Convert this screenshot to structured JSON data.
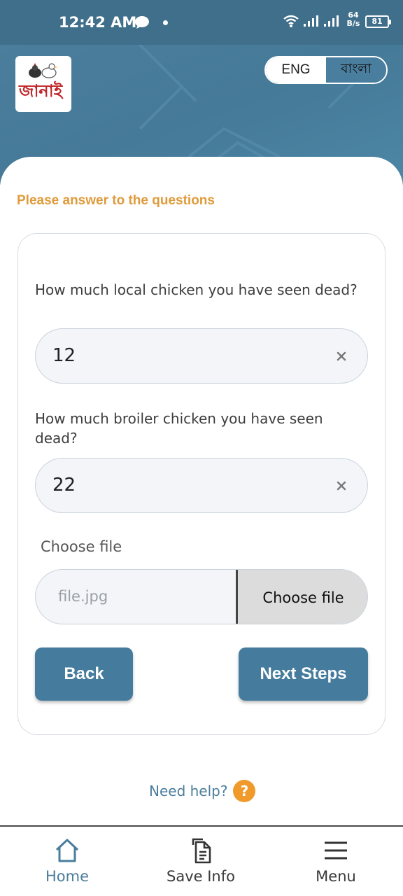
{
  "status_bar": {
    "time": "12:42 AM",
    "net_speed_value": "64",
    "net_speed_unit": "B/s",
    "battery": "81",
    "icons": [
      "chat-icon",
      "wifi-icon",
      "signal-icon",
      "battery-icon"
    ]
  },
  "header": {
    "logo_text": "জানাই",
    "lang_en": "ENG",
    "lang_bn": "বাংলা",
    "selected_lang": "ENG"
  },
  "form": {
    "section_title": "Please answer to the questions",
    "q1_label": "How much local chicken you have seen dead?",
    "q1_value": "12",
    "q2_label": "How much broiler chicken you have seen dead?",
    "q2_value": "22",
    "file_label": "Choose file",
    "file_name": "file.jpg",
    "file_button": "Choose file",
    "back_label": "Back",
    "next_label": "Next Steps"
  },
  "help": {
    "text": "Need help?",
    "icon_glyph": "?"
  },
  "bottom_nav": {
    "items": [
      {
        "label": "Home",
        "icon": "home-icon",
        "active": true
      },
      {
        "label": "Save Info",
        "icon": "document-icon",
        "active": false
      },
      {
        "label": "Menu",
        "icon": "hamburger-icon",
        "active": false
      }
    ]
  },
  "colors": {
    "primary": "#457b9d",
    "status_bar": "#3f6f8b",
    "accent_orange": "#df9b3b",
    "help_orange": "#ef9a2a"
  }
}
